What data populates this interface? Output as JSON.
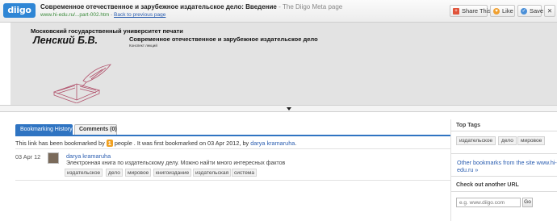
{
  "toolbar": {
    "logo": "diigo",
    "title": "Современное отечественное и зарубежное издательское дело: Введение",
    "title_suffix": " - The Diigo Meta page",
    "url": "www.hi-edu.ru/...part-002.htm",
    "url_separator": " - ",
    "back_link": "Back to previous page",
    "share_label": "Share This",
    "like_label": "Like",
    "save_label": "Save",
    "close_label": "✕"
  },
  "preview": {
    "university": "Московский государственный университет печати",
    "author": "Ленский Б.В.",
    "book_title": "Современное отечественное и зарубежное издательское дело",
    "notes": "Конспект лекций"
  },
  "main": {
    "tabs": [
      {
        "label": "Bookmarking History"
      },
      {
        "label": "Comments (0)"
      }
    ],
    "summary": {
      "prefix": "This link has been bookmarked by ",
      "count": "1",
      "middle": " people . It was first bookmarked on 03 Apr 2012, by ",
      "user": "darya kramaruha",
      "suffix": "."
    },
    "bookmarks": [
      {
        "date": "03 Apr 12",
        "user": "darya kramaruha",
        "description": "Электронная книга по издательскому делу. Можно найти много интересных фактов",
        "tags": [
          "издательское",
          "дело",
          "мировое",
          "книгоиздание",
          "издательская",
          "система"
        ]
      }
    ]
  },
  "sidebar": {
    "top_tags_heading": "Top Tags",
    "top_tags": [
      "издательское",
      "дело",
      "мировое"
    ],
    "other_bookmarks": "Other bookmarks from the site www.hi-edu.ru »",
    "check_heading": "Check out another URL",
    "url_placeholder": "e.g. www.diigo.com",
    "go_label": "Go"
  },
  "colors": {
    "accent": "#2f74c2",
    "count_badge": "#f0a020",
    "link": "#2a5db0"
  }
}
